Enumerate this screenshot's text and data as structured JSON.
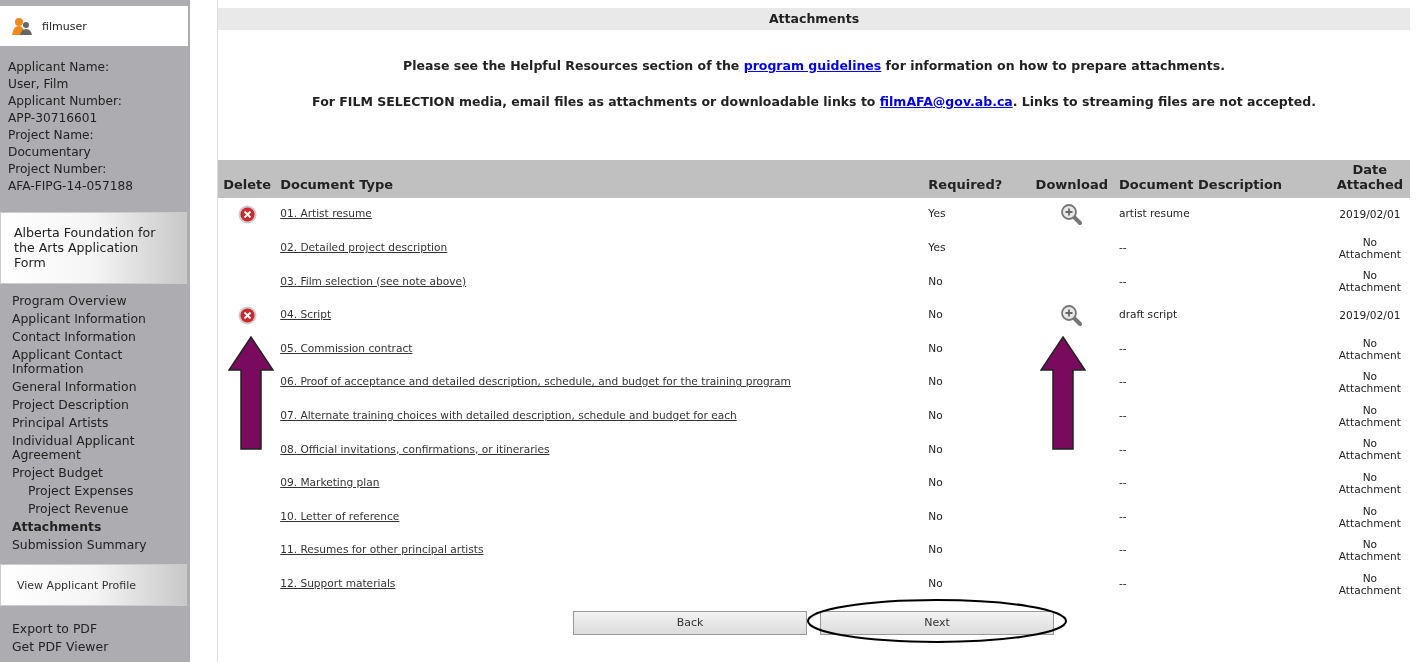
{
  "sidebar": {
    "user": "filmuser",
    "applicant_info": [
      {
        "label": "Applicant Name:",
        "value": "User, Film"
      },
      {
        "label": "Applicant Number:",
        "value": "APP-30716601"
      },
      {
        "label": "Project Name:",
        "value": "Documentary"
      },
      {
        "label": "Project Number:",
        "value": "AFA-FIPG-14-057188"
      }
    ],
    "form_title": "Alberta Foundation for the Arts Application Form",
    "nav_items": [
      {
        "label": "Program Overview",
        "selected": false
      },
      {
        "label": "Applicant Information",
        "selected": false
      },
      {
        "label": "Contact Information",
        "selected": false
      },
      {
        "label": "Applicant Contact Information",
        "selected": false
      },
      {
        "label": "General Information",
        "selected": false
      },
      {
        "label": "Project Description",
        "selected": false
      },
      {
        "label": "Principal Artists",
        "selected": false
      },
      {
        "label": "Individual Applicant Agreement",
        "selected": false
      },
      {
        "label": "Project Budget",
        "selected": false,
        "children": [
          {
            "label": "Project Expenses",
            "selected": false
          },
          {
            "label": "Project Revenue",
            "selected": false
          }
        ]
      },
      {
        "label": "Attachments",
        "selected": true
      },
      {
        "label": "Submission Summary",
        "selected": false
      }
    ],
    "profile_button": "View Applicant Profile",
    "links": [
      "Export to PDF",
      "Get PDF Viewer"
    ]
  },
  "main": {
    "title": "Attachments",
    "notes": [
      [
        {
          "text": "Please see the Helpful Resources section of the "
        },
        {
          "link": "program guidelines"
        },
        {
          "text": " for information on how to prepare attachments."
        }
      ],
      [
        {
          "text": "For FILM SELECTION media, email files as attachments or downloadable links to "
        },
        {
          "link": "filmAFA@gov.ab.ca"
        },
        {
          "text": ". Links to streaming files are not accepted."
        }
      ]
    ],
    "table": {
      "columns": [
        "Delete",
        "Document Type",
        "Required?",
        "Download",
        "Document Description",
        "Date Attached"
      ],
      "rows": [
        {
          "delete": true,
          "document_type": "01. Artist resume",
          "required": "Yes",
          "download": true,
          "description": "artist resume",
          "date": "2019/02/01"
        },
        {
          "delete": false,
          "document_type": "02. Detailed project description",
          "required": "Yes",
          "download": false,
          "description": "--",
          "date": "No Attachment"
        },
        {
          "delete": false,
          "document_type": "03. Film selection (see note above)",
          "required": "No",
          "download": false,
          "description": "--",
          "date": "No Attachment"
        },
        {
          "delete": true,
          "document_type": "04. Script",
          "required": "No",
          "download": true,
          "description": "draft script",
          "date": "2019/02/01"
        },
        {
          "delete": false,
          "document_type": "05. Commission contract",
          "required": "No",
          "download": false,
          "description": "--",
          "date": "No Attachment"
        },
        {
          "delete": false,
          "document_type": "06. Proof of acceptance and detailed description, schedule, and budget for the training program",
          "required": "No",
          "download": false,
          "description": "--",
          "date": "No Attachment"
        },
        {
          "delete": false,
          "document_type": "07. Alternate training choices with detailed description, schedule and budget for each",
          "required": "No",
          "download": false,
          "description": "--",
          "date": "No Attachment"
        },
        {
          "delete": false,
          "document_type": "08. Official invitations, confirmations, or itineraries",
          "required": "No",
          "download": false,
          "description": "--",
          "date": "No Attachment"
        },
        {
          "delete": false,
          "document_type": "09. Marketing plan",
          "required": "No",
          "download": false,
          "description": "--",
          "date": "No Attachment"
        },
        {
          "delete": false,
          "document_type": "10. Letter of reference",
          "required": "No",
          "download": false,
          "description": "--",
          "date": "No Attachment"
        },
        {
          "delete": false,
          "document_type": "11. Resumes for other principal artists",
          "required": "No",
          "download": false,
          "description": "--",
          "date": "No Attachment"
        },
        {
          "delete": false,
          "document_type": "12. Support materials",
          "required": "No",
          "download": false,
          "description": "--",
          "date": "No Attachment"
        }
      ]
    },
    "buttons": [
      {
        "label": "Back",
        "circled": false
      },
      {
        "label": "Next",
        "circled": true
      }
    ],
    "annotations": [
      {
        "kind": "arrow"
      },
      {
        "kind": "arrow"
      }
    ]
  }
}
